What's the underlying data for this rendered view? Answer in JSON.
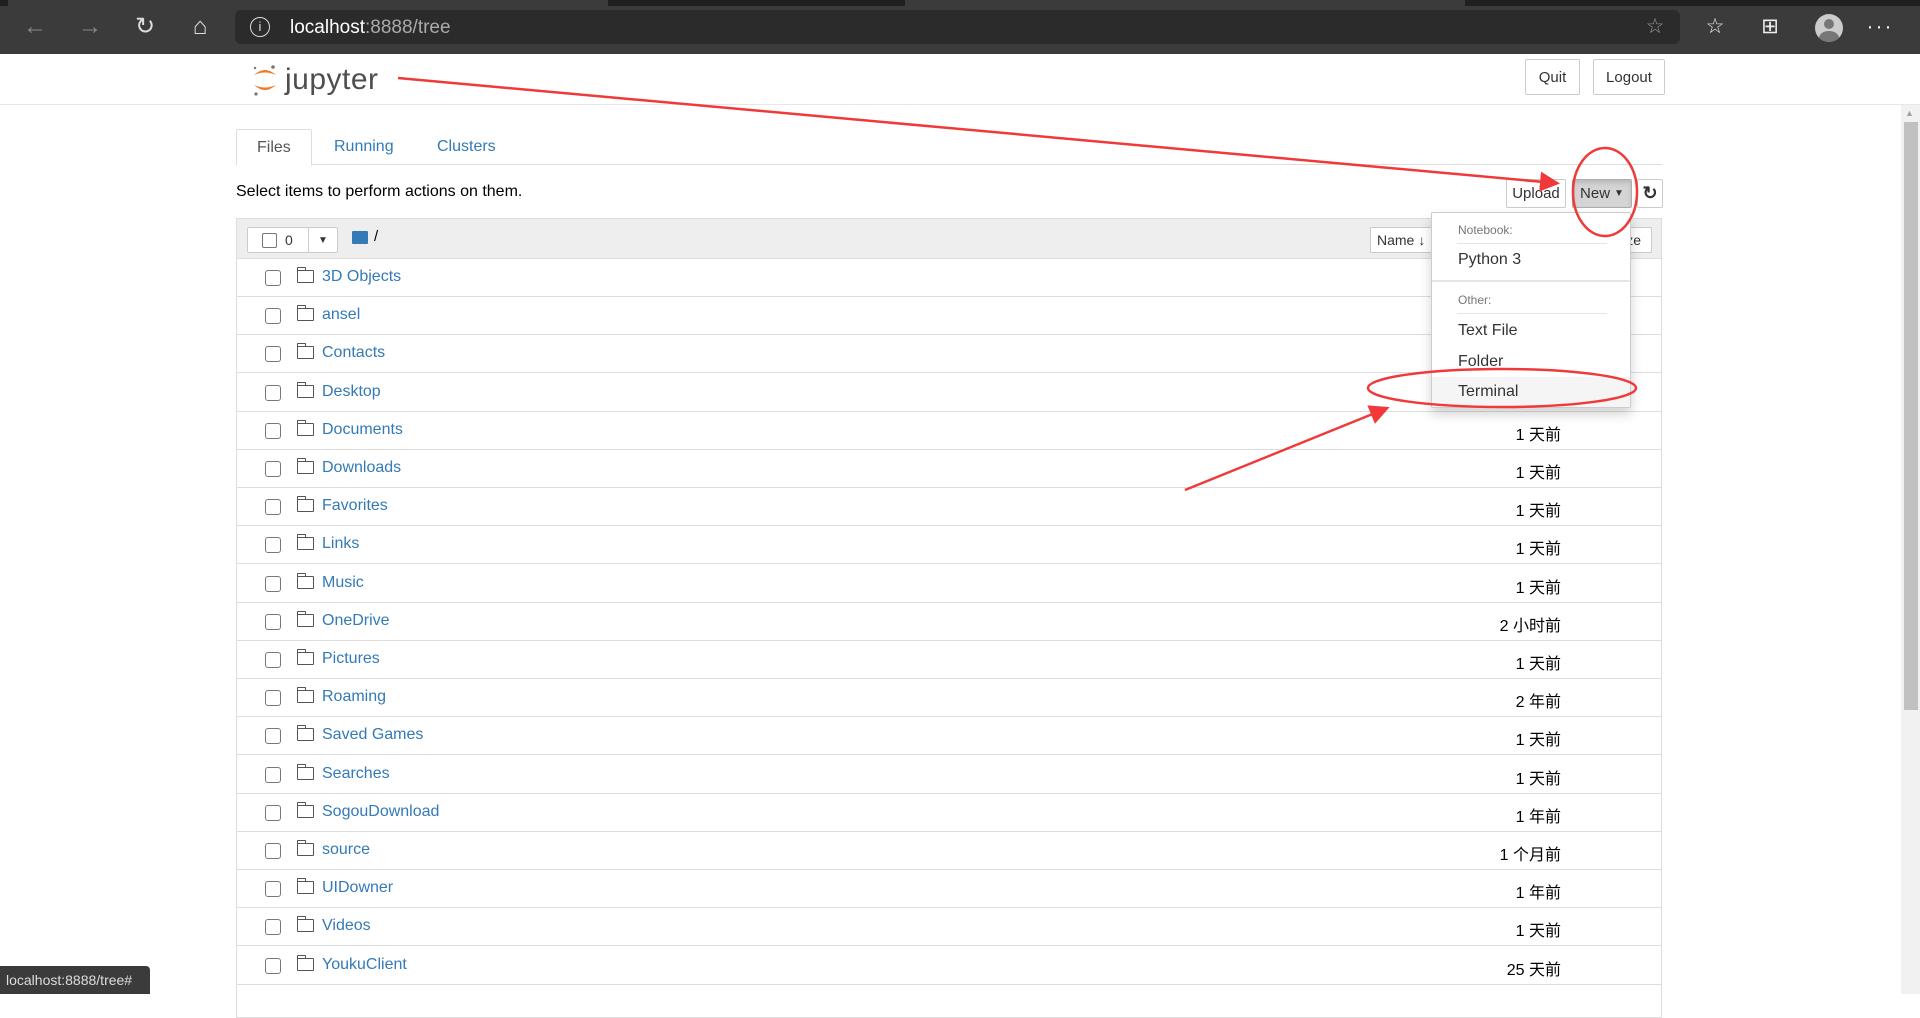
{
  "browser": {
    "url_host": "localhost",
    "url_rest": ":8888/tree",
    "status_url": "localhost:8888/tree#",
    "icons": [
      "back-icon",
      "forward-icon",
      "refresh-icon",
      "home-icon",
      "info-icon",
      "favorite-add-icon",
      "favorites-icon",
      "collections-icon",
      "profile-icon",
      "more-icon"
    ]
  },
  "header": {
    "logo_text": "jupyter",
    "quit_label": "Quit",
    "logout_label": "Logout"
  },
  "tabs": [
    {
      "label": "Files",
      "active": true
    },
    {
      "label": "Running",
      "active": false
    },
    {
      "label": "Clusters",
      "active": false
    }
  ],
  "toolbar": {
    "hint": "Select items to perform actions on them.",
    "upload_label": "Upload",
    "new_label": "New",
    "selected_count": "0",
    "breadcrumb": "/"
  },
  "list_header": {
    "name_label": "Name",
    "size_label": "File size"
  },
  "new_menu": {
    "notebook_header": "Notebook:",
    "python_label": "Python 3",
    "other_header": "Other:",
    "text_file_label": "Text File",
    "folder_label": "Folder",
    "terminal_label": "Terminal"
  },
  "files": [
    {
      "name": "3D Objects",
      "modified": ""
    },
    {
      "name": "ansel",
      "modified": ""
    },
    {
      "name": "Contacts",
      "modified": ""
    },
    {
      "name": "Desktop",
      "modified": ""
    },
    {
      "name": "Documents",
      "modified": "1 天前"
    },
    {
      "name": "Downloads",
      "modified": "1 天前"
    },
    {
      "name": "Favorites",
      "modified": "1 天前"
    },
    {
      "name": "Links",
      "modified": "1 天前"
    },
    {
      "name": "Music",
      "modified": "1 天前"
    },
    {
      "name": "OneDrive",
      "modified": "2 小时前"
    },
    {
      "name": "Pictures",
      "modified": "1 天前"
    },
    {
      "name": "Roaming",
      "modified": "2 年前"
    },
    {
      "name": "Saved Games",
      "modified": "1 天前"
    },
    {
      "name": "Searches",
      "modified": "1 天前"
    },
    {
      "name": "SogouDownload",
      "modified": "1 年前"
    },
    {
      "name": "source",
      "modified": "1 个月前"
    },
    {
      "name": "UIDowner",
      "modified": "1 年前"
    },
    {
      "name": "Videos",
      "modified": "1 天前"
    },
    {
      "name": "YoukuClient",
      "modified": "25 天前"
    }
  ],
  "colors": {
    "link": "#337ab7",
    "annotation": "#f03a3a",
    "jupyter_orange": "#f37726"
  }
}
